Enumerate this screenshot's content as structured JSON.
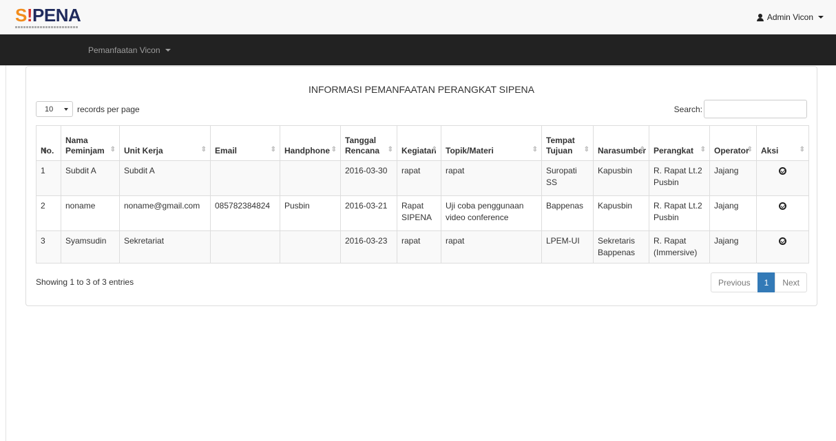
{
  "header": {
    "logo": {
      "s": "S",
      "bang": "!",
      "rest": "PENA"
    },
    "user": "Admin Vicon"
  },
  "nav": {
    "menu": "Pemanfaatan Vicon"
  },
  "panel": {
    "title": "INFORMASI PEMANFAATAN PERANGKAT SIPENA",
    "length_value": "10",
    "length_label": "records per page",
    "search_label": "Search:",
    "columns": [
      "No.",
      "Nama Peminjam",
      "Unit Kerja",
      "Email",
      "Handphone",
      "Tanggal Rencana",
      "Kegiatan",
      "Topik/Materi",
      "Tempat Tujuan",
      "Narasumber",
      "Perangkat",
      "Operator",
      "Aksi"
    ],
    "rows": [
      [
        "1",
        "Subdit A",
        "Subdit A",
        "",
        "",
        "2016-03-30",
        "rapat",
        "rapat",
        "Suropati SS",
        "Kapusbin",
        "R. Rapat Lt.2 Pusbin",
        "Jajang"
      ],
      [
        "2",
        "noname",
        "noname@gmail.com",
        "085782384824",
        "Pusbin",
        "2016-03-21",
        "Rapat SIPENA",
        "Uji coba penggunaan video conference",
        "Bappenas",
        "Kapusbin",
        "R. Rapat Lt.2 Pusbin",
        "Jajang"
      ],
      [
        "3",
        "Syamsudin",
        "Sekretariat",
        "",
        "",
        "2016-03-23",
        "rapat",
        "rapat",
        "LPEM-UI",
        "Sekretaris Bappenas",
        "R. Rapat (Immersive)",
        "Jajang"
      ]
    ],
    "row_action_icon": "check-circle-icon",
    "info": "Showing 1 to 3 of 3 entries",
    "pager": {
      "previous": "Previous",
      "page": "1",
      "next": "Next"
    }
  }
}
